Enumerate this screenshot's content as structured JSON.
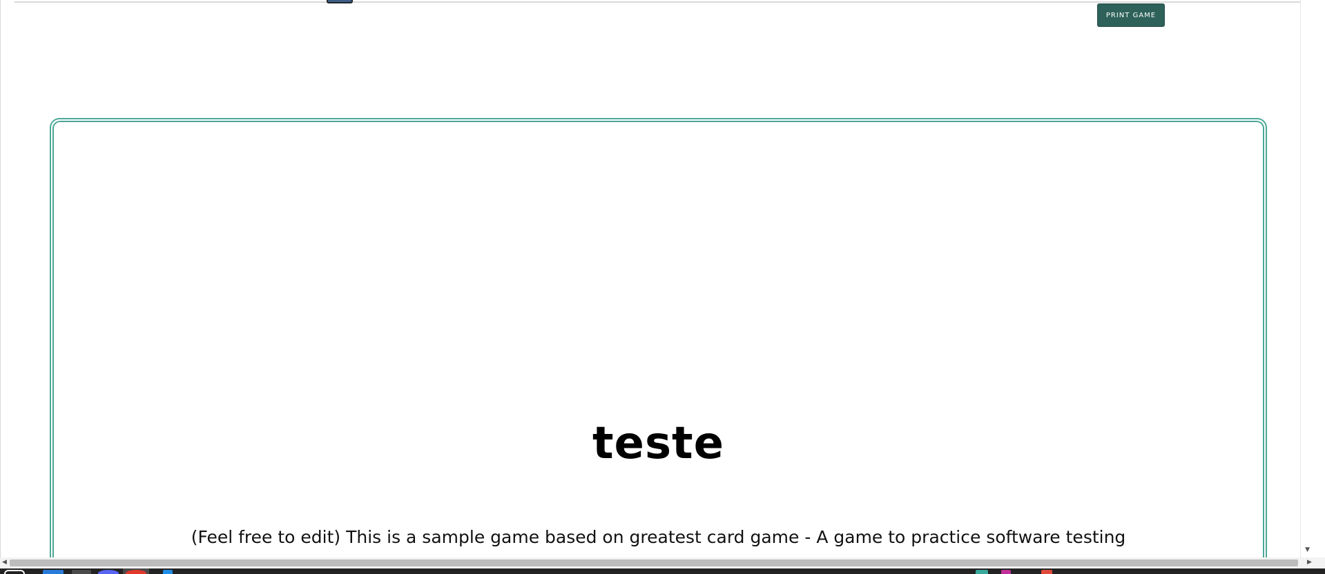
{
  "header": {
    "print_button_label": "PRINT GAME"
  },
  "card": {
    "title": "teste",
    "description": "(Feel free to edit) This is a sample game based on greatest card game - A game to practice software testing"
  },
  "colors": {
    "accent": "#2d615a",
    "card_border": "#4aa796"
  },
  "taskbar": {
    "icons": [
      "start-icon",
      "file-explorer-icon",
      "terminal-icon",
      "discord-icon",
      "browser-icon",
      "edge-icon",
      "tray-icon-1",
      "tray-icon-2",
      "tray-icon-3"
    ]
  }
}
